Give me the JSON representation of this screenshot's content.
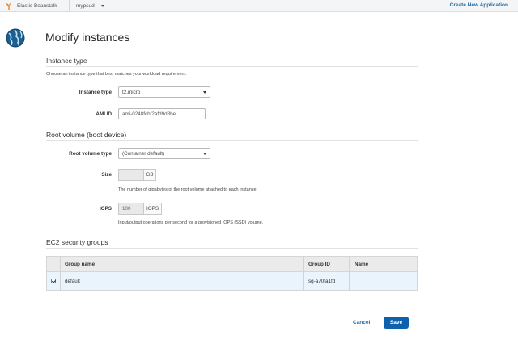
{
  "topbar": {
    "breadcrumb_service": "Elastic Beanstalk",
    "breadcrumb_app": "mypsud",
    "create_link": "Create New Application"
  },
  "page": {
    "title": "Modify instances"
  },
  "instance_type": {
    "section_title": "Instance type",
    "description": "Choose an instance type that best matches your workload requirement.",
    "type_label": "Instance type",
    "type_value": "t2.micro",
    "ami_label": "AMI ID",
    "ami_value": "ami-0248fcbf2afd9d8be"
  },
  "root_volume": {
    "section_title": "Root volume (boot device)",
    "type_label": "Root volume type",
    "type_value": "(Container default)",
    "size_label": "Size",
    "size_value": "",
    "size_unit": "GB",
    "size_help": "The number of gigabytes of the root volume attached to each instance.",
    "iops_label": "IOPS",
    "iops_value": "100",
    "iops_unit": "IOPS",
    "iops_help": "Input/output operations per second for a provisioned IOPS (SSD) volume."
  },
  "security_groups": {
    "section_title": "EC2 security groups",
    "columns": [
      "Group name",
      "Group ID",
      "Name"
    ],
    "rows": [
      {
        "checked": true,
        "group_name": "default",
        "group_id": "sg-a70fa1fd",
        "name": ""
      }
    ]
  },
  "actions": {
    "cancel": "Cancel",
    "save": "Save"
  },
  "colors": {
    "accent": "#1a6aa8",
    "primary_button": "#0e62ad",
    "selected_row": "#eaf4fc",
    "logo_orange": "#e8831e"
  },
  "icons": {
    "service_logo": "beanstalk-icon",
    "page_logo": "globe-icon"
  }
}
